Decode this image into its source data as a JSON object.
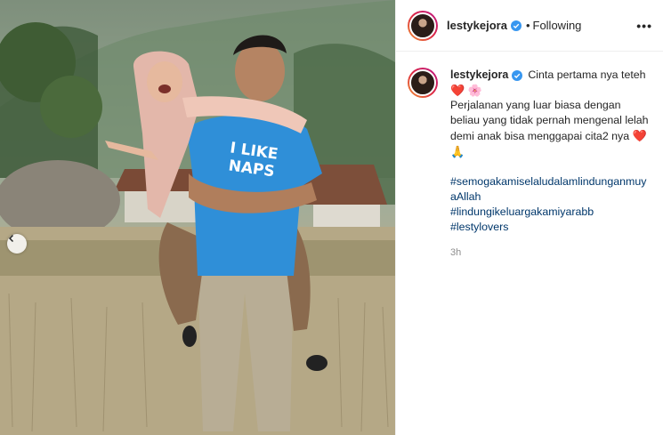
{
  "post": {
    "username": "lestykejora",
    "follow_state": "Following",
    "separator": "•",
    "more_label": "•••"
  },
  "caption": {
    "username": "lestykejora",
    "first_line": "Cinta pertama nya teteh",
    "first_emojis": "❤️ 🌸",
    "body": "Perjalanan yang luar biasa dengan beliau yang tidak pernah mengenal lelah demi anak bisa menggapai cita2 nya",
    "body_emojis": "❤️ 🙏",
    "hashtags": [
      "#semogakamiselaludalamlindunganmuyaAllah",
      "#lindungikeluargakamiyarabb",
      "#lestylovers"
    ],
    "time": "3h"
  },
  "photo": {
    "shirt_text_line1": "I LIKE",
    "shirt_text_line2": "NAPS"
  },
  "icons": {
    "verified": "verified-badge-icon",
    "prev": "chevron-left-icon"
  },
  "colors": {
    "link": "#00376b",
    "verified": "#3897f0",
    "muted": "#8e8e8e"
  }
}
